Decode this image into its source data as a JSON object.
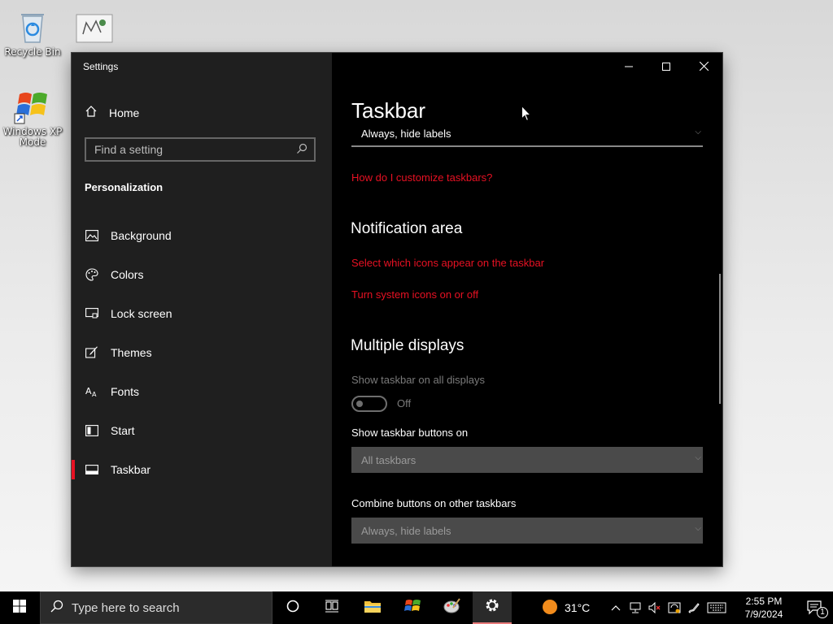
{
  "desktop": {
    "icons": [
      {
        "label": "Recycle Bin"
      },
      {
        "label": ""
      },
      {
        "label": "Windows XP Mode"
      }
    ]
  },
  "window": {
    "title": "Settings",
    "sidebar": {
      "home_label": "Home",
      "search_placeholder": "Find a setting",
      "section_title": "Personalization",
      "items": [
        {
          "label": "Background",
          "icon": "image-icon"
        },
        {
          "label": "Colors",
          "icon": "palette-icon"
        },
        {
          "label": "Lock screen",
          "icon": "lock-screen-icon"
        },
        {
          "label": "Themes",
          "icon": "brush-icon"
        },
        {
          "label": "Fonts",
          "icon": "fonts-icon"
        },
        {
          "label": "Start",
          "icon": "start-icon"
        },
        {
          "label": "Taskbar",
          "icon": "taskbar-icon",
          "active": true
        }
      ]
    },
    "content": {
      "page_title": "Taskbar",
      "top_select_value": "Always, hide labels",
      "customize_link": "How do I customize taskbars?",
      "notification_area": {
        "heading": "Notification area",
        "link1": "Select which icons appear on the taskbar",
        "link2": "Turn system icons on or off"
      },
      "multiple_displays": {
        "heading": "Multiple displays",
        "show_all_label": "Show taskbar on all displays",
        "toggle_state": "Off",
        "buttons_on_label": "Show taskbar buttons on",
        "buttons_on_value": "All taskbars",
        "combine_label": "Combine buttons on other taskbars",
        "combine_value": "Always, hide labels"
      }
    }
  },
  "taskbar": {
    "search_placeholder": "Type here to search",
    "weather_temp": "31°C",
    "time": "2:55 PM",
    "date": "7/9/2024",
    "notification_count": "1"
  },
  "colors": {
    "accent": "#e81123",
    "sidebar_bg": "#1f1f1f",
    "content_bg": "#000000"
  }
}
